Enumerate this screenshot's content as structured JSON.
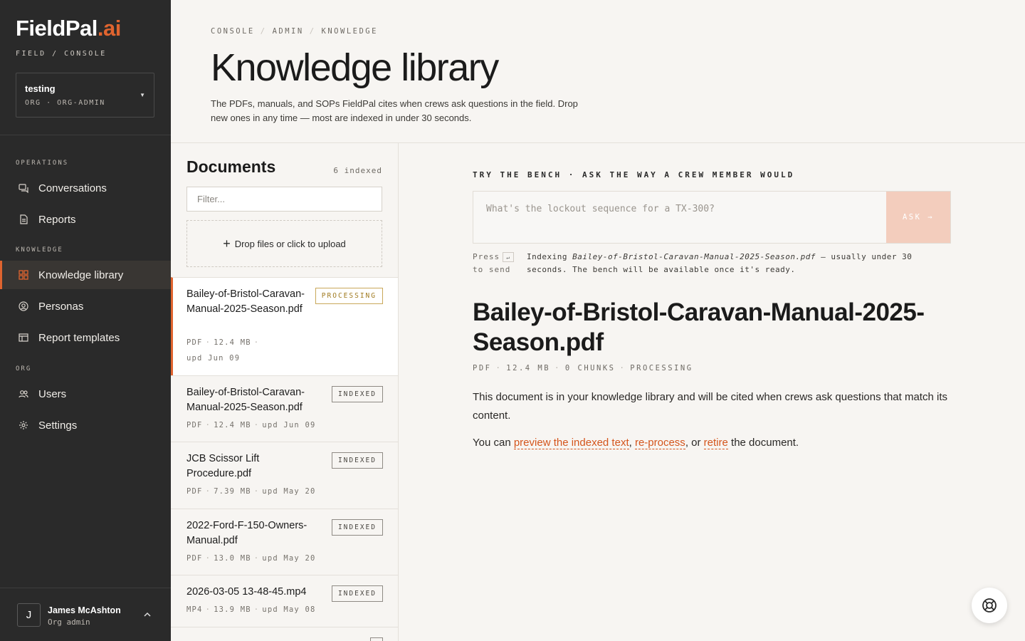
{
  "brand": {
    "name": "FieldPal",
    "accent": ".ai",
    "sub": "FIELD / CONSOLE"
  },
  "org": {
    "name": "testing",
    "meta": "ORG · ORG-ADMIN"
  },
  "sidebar": {
    "sections": [
      "OPERATIONS",
      "KNOWLEDGE",
      "ORG"
    ],
    "items": [
      {
        "label": "Conversations",
        "icon": "chat-icon"
      },
      {
        "label": "Reports",
        "icon": "report-icon"
      },
      {
        "label": "Knowledge library",
        "icon": "library-icon",
        "active": true
      },
      {
        "label": "Personas",
        "icon": "persona-icon"
      },
      {
        "label": "Report templates",
        "icon": "template-icon"
      },
      {
        "label": "Users",
        "icon": "users-icon"
      },
      {
        "label": "Settings",
        "icon": "gear-icon"
      }
    ]
  },
  "user": {
    "initial": "J",
    "name": "James McAshton",
    "role": "Org admin"
  },
  "breadcrumb": [
    "CONSOLE",
    "ADMIN",
    "KNOWLEDGE"
  ],
  "page": {
    "title": "Knowledge library",
    "description": "The PDFs, manuals, and SOPs FieldPal cites when crews ask questions in the field. Drop new ones in any time — most are indexed in under 30 seconds."
  },
  "documents": {
    "title": "Documents",
    "count": "6 indexed",
    "filter_placeholder": "Filter...",
    "upload_label": "Drop files or click to upload",
    "items": [
      {
        "name": "Bailey-of-Bristol-Caravan-Manual-2025-Season.pdf",
        "type": "PDF",
        "size": "12.4 MB",
        "updated": "upd Jun 09",
        "status": "PROCESSING"
      },
      {
        "name": "Bailey-of-Bristol-Caravan-Manual-2025-Season.pdf",
        "type": "PDF",
        "size": "12.4 MB",
        "updated": "upd Jun 09",
        "status": "INDEXED"
      },
      {
        "name": "JCB Scissor Lift Procedure.pdf",
        "type": "PDF",
        "size": "7.39 MB",
        "updated": "upd May 20",
        "status": "INDEXED"
      },
      {
        "name": "2022-Ford-F-150-Owners-Manual.pdf",
        "type": "PDF",
        "size": "13.0 MB",
        "updated": "upd May 20",
        "status": "INDEXED"
      },
      {
        "name": "2026-03-05 13-48-45.mp4",
        "type": "MP4",
        "size": "13.9 MB",
        "updated": "upd May 08",
        "status": "INDEXED"
      }
    ]
  },
  "bench": {
    "label": "TRY THE BENCH · ASK THE WAY A CREW MEMBER WOULD",
    "placeholder": "What's the lockout sequence for a TX-300?",
    "button": "ASK →",
    "hint_press": "Press",
    "hint_key": "↵",
    "hint_send": "to send",
    "indexing_prefix": "Indexing",
    "indexing_file": "Bailey-of-Bristol-Caravan-Manual-2025-Season.pdf",
    "indexing_suffix": "— usually under 30 seconds. The bench will be available once it's ready."
  },
  "detail": {
    "title": "Bailey-of-Bristol-Caravan-Manual-2025-Season.pdf",
    "type": "PDF",
    "size": "12.4 MB",
    "chunks": "0 CHUNKS",
    "status": "PROCESSING",
    "body": "This document is in your knowledge library and will be cited when crews ask questions that match its content.",
    "actions_prefix": "You can",
    "link_preview": "preview the indexed text",
    "link_reprocess": "re-process",
    "link_retire": "retire",
    "sep1": ",",
    "sep2": ", or",
    "actions_suffix": "the document."
  },
  "colors": {
    "accent": "#e0642f",
    "sidebar_bg": "#2a2a2a",
    "page_bg": "#f7f5f2"
  }
}
